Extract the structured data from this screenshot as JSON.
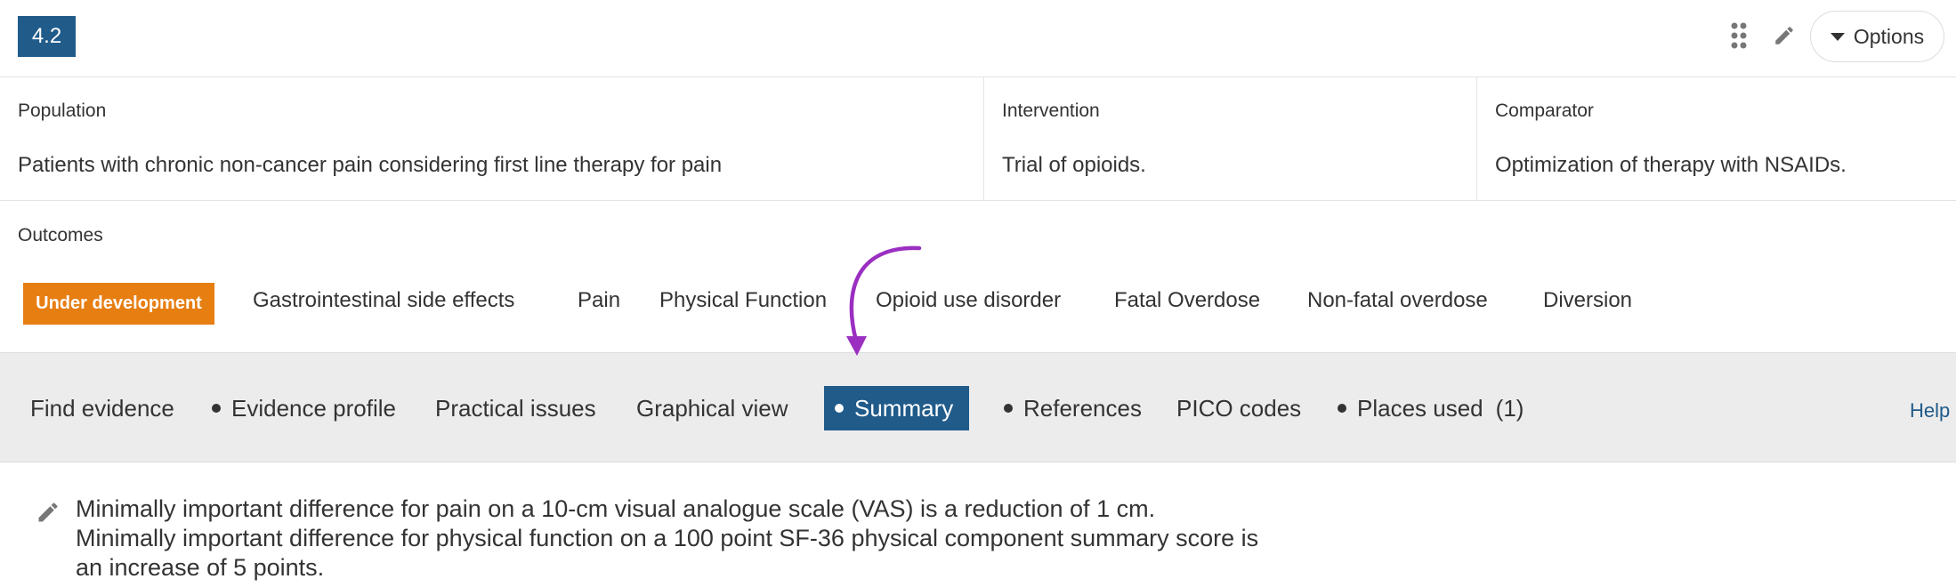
{
  "header": {
    "badge": "4.2",
    "options_label": "Options",
    "icons": [
      "drag-handle-icon",
      "pencil-icon",
      "caret-down-icon"
    ]
  },
  "pico": {
    "population": {
      "label": "Population",
      "value": "Patients with chronic non-cancer pain considering first line therapy for pain"
    },
    "intervention": {
      "label": "Intervention",
      "value": "Trial of opioids."
    },
    "comparator": {
      "label": "Comparator",
      "value": "Optimization of therapy with NSAIDs."
    }
  },
  "outcomes": {
    "label": "Outcomes",
    "status": "Under development",
    "items": [
      "Gastrointestinal side effects",
      "Pain",
      "Physical Function",
      "Opioid use disorder",
      "Fatal Overdose",
      "Non-fatal overdose",
      "Diversion"
    ]
  },
  "tabs": {
    "items": [
      {
        "label": "Find evidence",
        "dot": false
      },
      {
        "label": "Evidence profile",
        "dot": true
      },
      {
        "label": "Practical issues",
        "dot": false
      },
      {
        "label": "Graphical view",
        "dot": false
      },
      {
        "label": "Summary",
        "dot": true,
        "active": true
      },
      {
        "label": "References",
        "dot": true
      },
      {
        "label": "PICO codes",
        "dot": false
      },
      {
        "label": "Places used",
        "dot": true
      },
      {
        "label": "(1)",
        "dot": false
      }
    ],
    "help_label": "Help"
  },
  "summary": {
    "lines": [
      "Minimally important difference for pain on a 10-cm visual analogue scale (VAS) is a reduction of 1 cm.",
      "Minimally important difference for physical function on a 100 point SF-36 physical component summary score is",
      "an increase of 5 points."
    ]
  },
  "colors": {
    "brand_blue": "#205b8a",
    "status_orange": "#e77e12",
    "annotation_purple": "#9b2fc1",
    "tabbar_bg": "#ececec"
  }
}
